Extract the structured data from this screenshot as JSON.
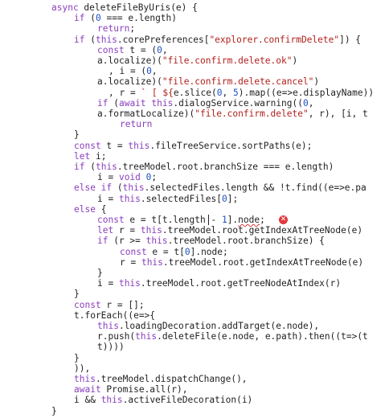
{
  "editor": {
    "lines": [
      [
        [
          "kw",
          "async "
        ],
        [
          "plain",
          "deleteFileByUris(e) {"
        ]
      ],
      [
        [
          "kw",
          "if "
        ],
        [
          "plain",
          "("
        ],
        [
          "num",
          "0"
        ],
        [
          "plain",
          " === e.length)"
        ]
      ],
      [
        [
          "kw",
          "return"
        ],
        [
          "plain",
          ";"
        ]
      ],
      [
        [
          "kw",
          "if "
        ],
        [
          "plain",
          "("
        ],
        [
          "th",
          "this"
        ],
        [
          "plain",
          ".corePreferences["
        ],
        [
          "str",
          "\"explorer.confirmDelete\""
        ],
        [
          "plain",
          "]) {"
        ]
      ],
      [
        [
          "kw",
          "const "
        ],
        [
          "plain",
          "t = ("
        ],
        [
          "num",
          "0"
        ],
        [
          "plain",
          ","
        ]
      ],
      [
        [
          "plain",
          "a.localize)("
        ],
        [
          "str",
          "\"file.confirm.delete.ok\""
        ],
        [
          "plain",
          ")"
        ]
      ],
      [
        [
          "plain",
          ", i = ("
        ],
        [
          "num",
          "0"
        ],
        [
          "plain",
          ","
        ]
      ],
      [
        [
          "plain",
          "a.localize)("
        ],
        [
          "str",
          "\"file.confirm.delete.cancel\""
        ],
        [
          "plain",
          ")"
        ]
      ],
      [
        [
          "plain",
          ", r = "
        ],
        [
          "str",
          "` [ ${"
        ],
        [
          "plain",
          "e.slice("
        ],
        [
          "num",
          "0"
        ],
        [
          "plain",
          ", "
        ],
        [
          "num",
          "5"
        ],
        [
          "plain",
          ").map((e=>e.displayName))"
        ]
      ],
      [
        [
          "kw",
          "if "
        ],
        [
          "plain",
          "("
        ],
        [
          "kw",
          "await "
        ],
        [
          "th",
          "this"
        ],
        [
          "plain",
          ".dialogService.warning(("
        ],
        [
          "num",
          "0"
        ],
        [
          "plain",
          ","
        ]
      ],
      [
        [
          "plain",
          "a.formatLocalize)("
        ],
        [
          "str",
          "\"file.confirm.delete\""
        ],
        [
          "plain",
          ", r), [i, t"
        ]
      ],
      [
        [
          "kw",
          "return"
        ]
      ],
      [
        [
          "plain",
          "}"
        ]
      ],
      [
        [
          "kw",
          "const "
        ],
        [
          "plain",
          "t = "
        ],
        [
          "th",
          "this"
        ],
        [
          "plain",
          ".fileTreeService.sortPaths(e);"
        ]
      ],
      [
        [
          "kw",
          "let "
        ],
        [
          "plain",
          "i;"
        ]
      ],
      [
        [
          "kw",
          "if "
        ],
        [
          "plain",
          "("
        ],
        [
          "th",
          "this"
        ],
        [
          "plain",
          ".treeModel.root.branchSize === e.length)"
        ]
      ],
      [
        [
          "plain",
          "i = "
        ],
        [
          "kw",
          "void "
        ],
        [
          "num",
          "0"
        ],
        [
          "plain",
          ";"
        ]
      ],
      [
        [
          "kw",
          "else if "
        ],
        [
          "plain",
          "("
        ],
        [
          "th",
          "this"
        ],
        [
          "plain",
          ".selectedFiles.length && !t.find((e=>e.pa"
        ]
      ],
      [
        [
          "plain",
          "i = "
        ],
        [
          "th",
          "this"
        ],
        [
          "plain",
          ".selectedFiles["
        ],
        [
          "num",
          "0"
        ],
        [
          "plain",
          "];"
        ]
      ],
      [
        [
          "kw",
          "else "
        ],
        [
          "plain",
          "{"
        ]
      ],
      [
        [
          "kw",
          "const "
        ],
        [
          "plain",
          "e = t[t.len"
        ],
        [
          "plain",
          "gth - "
        ],
        [
          "num",
          "1"
        ],
        [
          "plain",
          "]."
        ],
        [
          "plain",
          "node"
        ],
        [
          "plain",
          ";"
        ]
      ],
      [
        [
          "kw",
          "let "
        ],
        [
          "plain",
          "r = "
        ],
        [
          "th",
          "this"
        ],
        [
          "plain",
          ".treeModel.root.getIndexAtTreeNode(e)"
        ]
      ],
      [
        [
          "kw",
          "if "
        ],
        [
          "plain",
          "(r >= "
        ],
        [
          "th",
          "this"
        ],
        [
          "plain",
          ".treeModel.root.branchSize) {"
        ]
      ],
      [
        [
          "kw",
          "const "
        ],
        [
          "plain",
          "e = t["
        ],
        [
          "num",
          "0"
        ],
        [
          "plain",
          "].node;"
        ]
      ],
      [
        [
          "plain",
          "r = "
        ],
        [
          "th",
          "this"
        ],
        [
          "plain",
          ".treeModel.root.getIndexAtTreeNode(e)"
        ]
      ],
      [
        [
          "plain",
          "}"
        ]
      ],
      [
        [
          "plain",
          "i = "
        ],
        [
          "th",
          "this"
        ],
        [
          "plain",
          ".treeModel.root.getTreeNodeAtIndex(r)"
        ]
      ],
      [
        [
          "plain",
          "}"
        ]
      ],
      [
        [
          "kw",
          "const "
        ],
        [
          "plain",
          "r = [];"
        ]
      ],
      [
        [
          "plain",
          "t.forEach((e=>{"
        ]
      ],
      [
        [
          "th",
          "this"
        ],
        [
          "plain",
          ".loadingDecoration.addTarget(e.node),"
        ]
      ],
      [
        [
          "plain",
          "r.push("
        ],
        [
          "th",
          "this"
        ],
        [
          "plain",
          ".deleteFile(e.node, e.path).then((t=>(t"
        ]
      ],
      [
        [
          "plain",
          "t))))"
        ]
      ],
      [
        [
          "plain",
          "}"
        ]
      ],
      [
        [
          "plain",
          ")),"
        ]
      ],
      [
        [
          "th",
          "this"
        ],
        [
          "plain",
          ".treeModel.dispatchChange(),"
        ]
      ],
      [
        [
          "kw",
          "await "
        ],
        [
          "plain",
          "Promise.all(r),"
        ]
      ],
      [
        [
          "plain",
          "i && "
        ],
        [
          "th",
          "this"
        ],
        [
          "plain",
          ".activeFileDecoration(i)"
        ]
      ],
      [
        [
          "plain",
          "}"
        ]
      ],
      [
        [
          "plain",
          "..."
        ]
      ]
    ],
    "indents": [
      64,
      92,
      121,
      92,
      121,
      121,
      135,
      121,
      135,
      121,
      121,
      149,
      92,
      92,
      92,
      92,
      121,
      92,
      121,
      92,
      121,
      121,
      121,
      149,
      149,
      121,
      121,
      92,
      92,
      92,
      121,
      121,
      121,
      92,
      92,
      92,
      92,
      92,
      64,
      92
    ],
    "error_icon": "error-x-icon"
  },
  "colors": {
    "keyword": "#8b3fbd",
    "string": "#b0201c",
    "number": "#1b50c7",
    "error": "#e0383e"
  }
}
